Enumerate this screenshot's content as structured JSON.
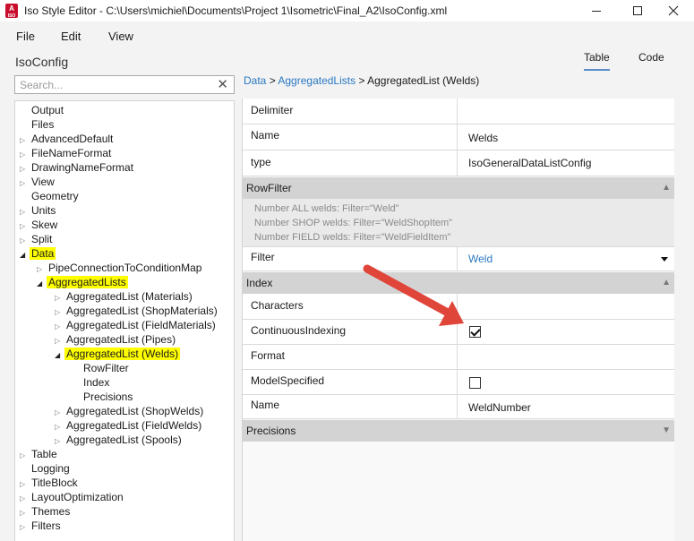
{
  "window": {
    "title": "Iso Style Editor - C:\\Users\\michiel\\Documents\\Project 1\\Isometric\\Final_A2\\IsoConfig.xml",
    "icon_text": "A",
    "icon_subtext": "ISO"
  },
  "menu": [
    "File",
    "Edit",
    "View"
  ],
  "root_title": "IsoConfig",
  "view_tabs": {
    "table": "Table",
    "code": "Code",
    "active": "Table"
  },
  "search": {
    "placeholder": "Search...",
    "value": ""
  },
  "tree": [
    {
      "label": "Output",
      "depth": 0,
      "expander": "",
      "highlight": false
    },
    {
      "label": "Files",
      "depth": 0,
      "expander": "",
      "highlight": false
    },
    {
      "label": "AdvancedDefault",
      "depth": 0,
      "expander": "▷",
      "highlight": false
    },
    {
      "label": "FileNameFormat",
      "depth": 0,
      "expander": "▷",
      "highlight": false
    },
    {
      "label": "DrawingNameFormat",
      "depth": 0,
      "expander": "▷",
      "highlight": false
    },
    {
      "label": "View",
      "depth": 0,
      "expander": "▷",
      "highlight": false
    },
    {
      "label": "Geometry",
      "depth": 0,
      "expander": "",
      "highlight": false
    },
    {
      "label": "Units",
      "depth": 0,
      "expander": "▷",
      "highlight": false
    },
    {
      "label": "Skew",
      "depth": 0,
      "expander": "▷",
      "highlight": false
    },
    {
      "label": "Split",
      "depth": 0,
      "expander": "▷",
      "highlight": false
    },
    {
      "label": "Data",
      "depth": 0,
      "expander": "◢",
      "highlight": true
    },
    {
      "label": "PipeConnectionToConditionMap",
      "depth": 1,
      "expander": "▷",
      "highlight": false
    },
    {
      "label": "AggregatedLists",
      "depth": 1,
      "expander": "◢",
      "highlight": true
    },
    {
      "label": "AggregatedList (Materials)",
      "depth": 2,
      "expander": "▷",
      "highlight": false
    },
    {
      "label": "AggregatedList (ShopMaterials)",
      "depth": 2,
      "expander": "▷",
      "highlight": false
    },
    {
      "label": "AggregatedList (FieldMaterials)",
      "depth": 2,
      "expander": "▷",
      "highlight": false
    },
    {
      "label": "AggregatedList (Pipes)",
      "depth": 2,
      "expander": "▷",
      "highlight": false
    },
    {
      "label": "AggregatedList (Welds)",
      "depth": 2,
      "expander": "◢",
      "highlight": true
    },
    {
      "label": "RowFilter",
      "depth": 3,
      "expander": "",
      "highlight": false
    },
    {
      "label": "Index",
      "depth": 3,
      "expander": "",
      "highlight": false
    },
    {
      "label": "Precisions",
      "depth": 3,
      "expander": "",
      "highlight": false
    },
    {
      "label": "AggregatedList (ShopWelds)",
      "depth": 2,
      "expander": "▷",
      "highlight": false
    },
    {
      "label": "AggregatedList (FieldWelds)",
      "depth": 2,
      "expander": "▷",
      "highlight": false
    },
    {
      "label": "AggregatedList (Spools)",
      "depth": 2,
      "expander": "▷",
      "highlight": false
    },
    {
      "label": "Table",
      "depth": 0,
      "expander": "▷",
      "highlight": false
    },
    {
      "label": "Logging",
      "depth": 0,
      "expander": "",
      "highlight": false
    },
    {
      "label": "TitleBlock",
      "depth": 0,
      "expander": "▷",
      "highlight": false
    },
    {
      "label": "LayoutOptimization",
      "depth": 0,
      "expander": "▷",
      "highlight": false
    },
    {
      "label": "Themes",
      "depth": 0,
      "expander": "▷",
      "highlight": false
    },
    {
      "label": "Filters",
      "depth": 0,
      "expander": "▷",
      "highlight": false
    }
  ],
  "breadcrumb": {
    "link1": "Data",
    "sep": " > ",
    "link2": "AggregatedLists",
    "current": "AggregatedList (Welds)"
  },
  "properties": {
    "delimiter": {
      "name": "Delimiter",
      "value": ""
    },
    "name": {
      "name": "Name",
      "value": "Welds"
    },
    "type": {
      "name": "type",
      "value": "IsoGeneralDataListConfig"
    },
    "rowfilter_section": "RowFilter",
    "rowfilter_hints": [
      "Number ALL welds:   Filter=\"Weld\"",
      "Number SHOP welds:  Filter=\"WeldShopItem\"",
      "Number FIELD welds: Filter=\"WeldFieldItem\""
    ],
    "filter": {
      "name": "Filter",
      "value": "Weld"
    },
    "index_section": "Index",
    "characters": {
      "name": "Characters",
      "value": ""
    },
    "continuous_indexing": {
      "name": "ContinuousIndexing",
      "checked": true
    },
    "format": {
      "name": "Format",
      "value": ""
    },
    "model_specified": {
      "name": "ModelSpecified",
      "checked": false
    },
    "index_name": {
      "name": "Name",
      "value": "WeldNumber"
    },
    "precisions_section": "Precisions"
  },
  "colors": {
    "highlight": "#ffff00",
    "link": "#2a78c2",
    "arrow": "#e0453a",
    "section": "#d3d3d3"
  }
}
